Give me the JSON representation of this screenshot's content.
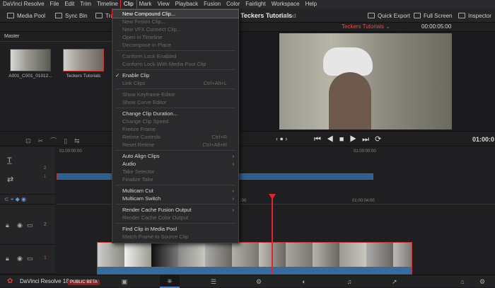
{
  "menubar": {
    "items": [
      "DaVinci Resolve",
      "File",
      "Edit",
      "Trim",
      "Timeline",
      "Clip",
      "Mark",
      "View",
      "Playback",
      "Fusion",
      "Color",
      "Fairlight",
      "Workspace",
      "Help"
    ],
    "active_index": 5
  },
  "toolbar": {
    "media_pool": "Media Pool",
    "sync_bin": "Sync Bin",
    "transitions_partial": "Tra",
    "project_title": "Teckers Tutorials",
    "edited": "Edited",
    "quick_export": "Quick Export",
    "full_screen": "Full Screen",
    "inspector": "Inspector"
  },
  "mediapool": {
    "bin": "Master",
    "clips": [
      {
        "label": "A001_C001_01012..."
      },
      {
        "label": "Teckers Tutorials"
      }
    ]
  },
  "viewer": {
    "timeline_name": "Teckers Tutorials",
    "timecode_top": "00:00:05:00",
    "timecode_main": "01:00:0"
  },
  "timeline": {
    "ruler_start": "01:00:00:00",
    "ruler_mid": "01:00:00:00",
    "ruler_b1": ":00",
    "ruler_b2": "01:00:04:00",
    "track_v2": "2",
    "track_v1": "1",
    "track_top2": "2",
    "track_top1": "1"
  },
  "clip_menu": {
    "items": [
      {
        "label": "New Compound Clip...",
        "enabled": true,
        "highlight": true
      },
      {
        "label": "New Fusion Clip...",
        "enabled": false
      },
      {
        "label": "New VFX Connect Clip...",
        "enabled": false
      },
      {
        "label": "Open in Timeline",
        "enabled": false
      },
      {
        "label": "Decompose in Place",
        "enabled": false
      },
      {
        "sep": true
      },
      {
        "label": "Conform Lock Enabled",
        "enabled": false
      },
      {
        "label": "Conform Lock With Media Pool Clip",
        "enabled": false
      },
      {
        "sep": true
      },
      {
        "label": "Enable Clip",
        "enabled": true,
        "checked": true
      },
      {
        "label": "Link Clips",
        "enabled": false,
        "shortcut": "Ctrl+Alt+L"
      },
      {
        "sep": true
      },
      {
        "label": "Show Keyframe Editor",
        "enabled": false
      },
      {
        "label": "Show Curve Editor",
        "enabled": false
      },
      {
        "sep": true
      },
      {
        "label": "Change Clip Duration...",
        "enabled": true
      },
      {
        "label": "Change Clip Speed",
        "enabled": false
      },
      {
        "label": "Freeze Frame",
        "enabled": false
      },
      {
        "label": "Retime Controls",
        "enabled": false,
        "shortcut": "Ctrl+R"
      },
      {
        "label": "Reset Retime",
        "enabled": false,
        "shortcut": "Ctrl+Alt+R"
      },
      {
        "sep": true
      },
      {
        "label": "Auto Align Clips",
        "enabled": true,
        "submenu": true
      },
      {
        "label": "Audio",
        "enabled": true,
        "submenu": true
      },
      {
        "label": "Take Selector",
        "enabled": false
      },
      {
        "label": "Finalize Take",
        "enabled": false
      },
      {
        "sep": true
      },
      {
        "label": "Multicam Cut",
        "enabled": true,
        "submenu": true
      },
      {
        "label": "Multicam Switch",
        "enabled": true,
        "submenu": true
      },
      {
        "sep": true
      },
      {
        "label": "Render Cache Fusion Output",
        "enabled": true,
        "submenu": true
      },
      {
        "label": "Render Cache Color Output",
        "enabled": false
      },
      {
        "sep": true
      },
      {
        "label": "Find Clip in Media Pool",
        "enabled": true
      },
      {
        "label": "Match Frame to Source Clip",
        "enabled": false
      }
    ]
  },
  "statusbar": {
    "app_name": "DaVinci Resolve 18",
    "badge": "PUBLIC BETA"
  },
  "colors": {
    "accent_red": "#e0262d",
    "clip_blue": "#2f5f8f"
  }
}
